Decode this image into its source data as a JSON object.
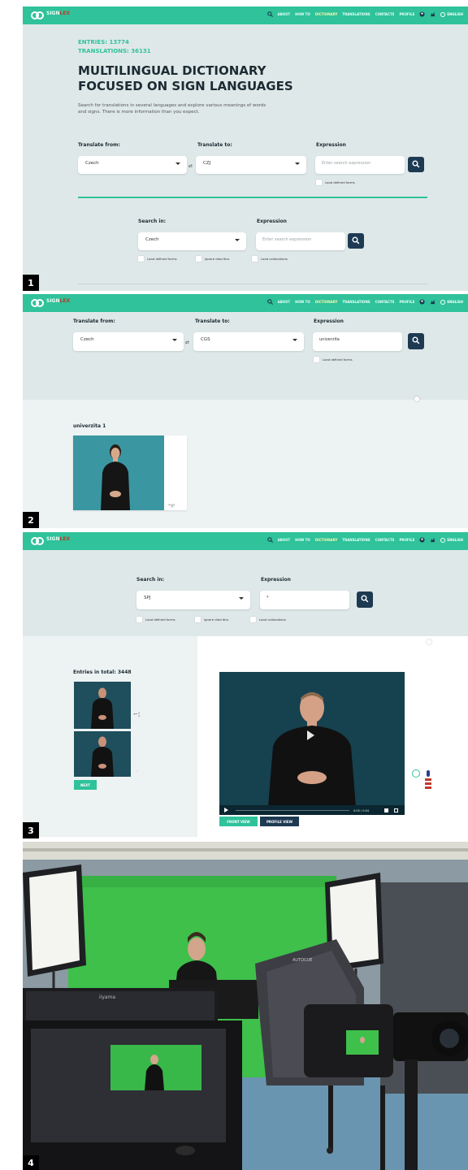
{
  "brand": {
    "name_part1": "SIGN",
    "name_part2": "LEX"
  },
  "nav": {
    "items": [
      "ABOUT",
      "HOW TO",
      "DICTIONARY",
      "TRANSLATIONS",
      "CONTACTS",
      "PROFILE"
    ],
    "active": "DICTIONARY",
    "language": "ENGLISH"
  },
  "panel1": {
    "number": "1",
    "stats_entries": "ENTRIES: 13774",
    "stats_translations": "TRANSLATIONS: 36131",
    "title_line1": "MULTILINGUAL DICTIONARY",
    "title_line2": "FOCUSED ON SIGN LANGUAGES",
    "description": "Search for translations in several languages and explore various meanings of words and signs. There is more information than you expect.",
    "translate_from_label": "Translate from:",
    "translate_from_value": "Czech",
    "translate_to_label": "Translate to:",
    "translate_to_value": "CZJ",
    "expression_label": "Expression",
    "expression_placeholder": "Enter search expression",
    "exact_match_label": "Load defined forms",
    "search_in_label": "Search in:",
    "search_in_value": "Czech",
    "expression2_label": "Expression",
    "expression2_placeholder": "Enter search expression",
    "opt1": "Load defined forms",
    "opt2": "Ignore diacritics",
    "opt3": "Load collocations"
  },
  "panel2": {
    "number": "2",
    "translate_from_label": "Translate from:",
    "translate_from_value": "Czech",
    "translate_to_label": "Translate to:",
    "translate_to_value": "CGS",
    "expression_label": "Expression",
    "expression_value": "univerzita",
    "exact_match_label": "Load defined forms",
    "result_word": "univerzita",
    "result_count": "1"
  },
  "panel3": {
    "number": "3",
    "search_in_label": "Search in:",
    "search_in_value": "SPJ",
    "expression_label": "Expression",
    "expression_value": "*",
    "opt1": "Load defined forms",
    "opt2": "Ignore diacritics",
    "opt3": "Load collocations",
    "entries_total": "Entries in total: 3448",
    "next_button": "NEXT",
    "video_time": "0:00 / 0:04",
    "front_view_button": "FRONT VIEW",
    "profile_view_button": "PROFILE VIEW"
  },
  "panel4": {
    "number": "4",
    "monitor_brand": "iiyama",
    "prompter_brand": "AUTOCUE"
  },
  "colors": {
    "teal": "#2fc29b",
    "navy": "#1d3a52",
    "panel_bg": "#dfe8e8",
    "video_teal": "#3a97a2",
    "video_dark": "#16414f",
    "green_screen": "#3ec04b"
  }
}
